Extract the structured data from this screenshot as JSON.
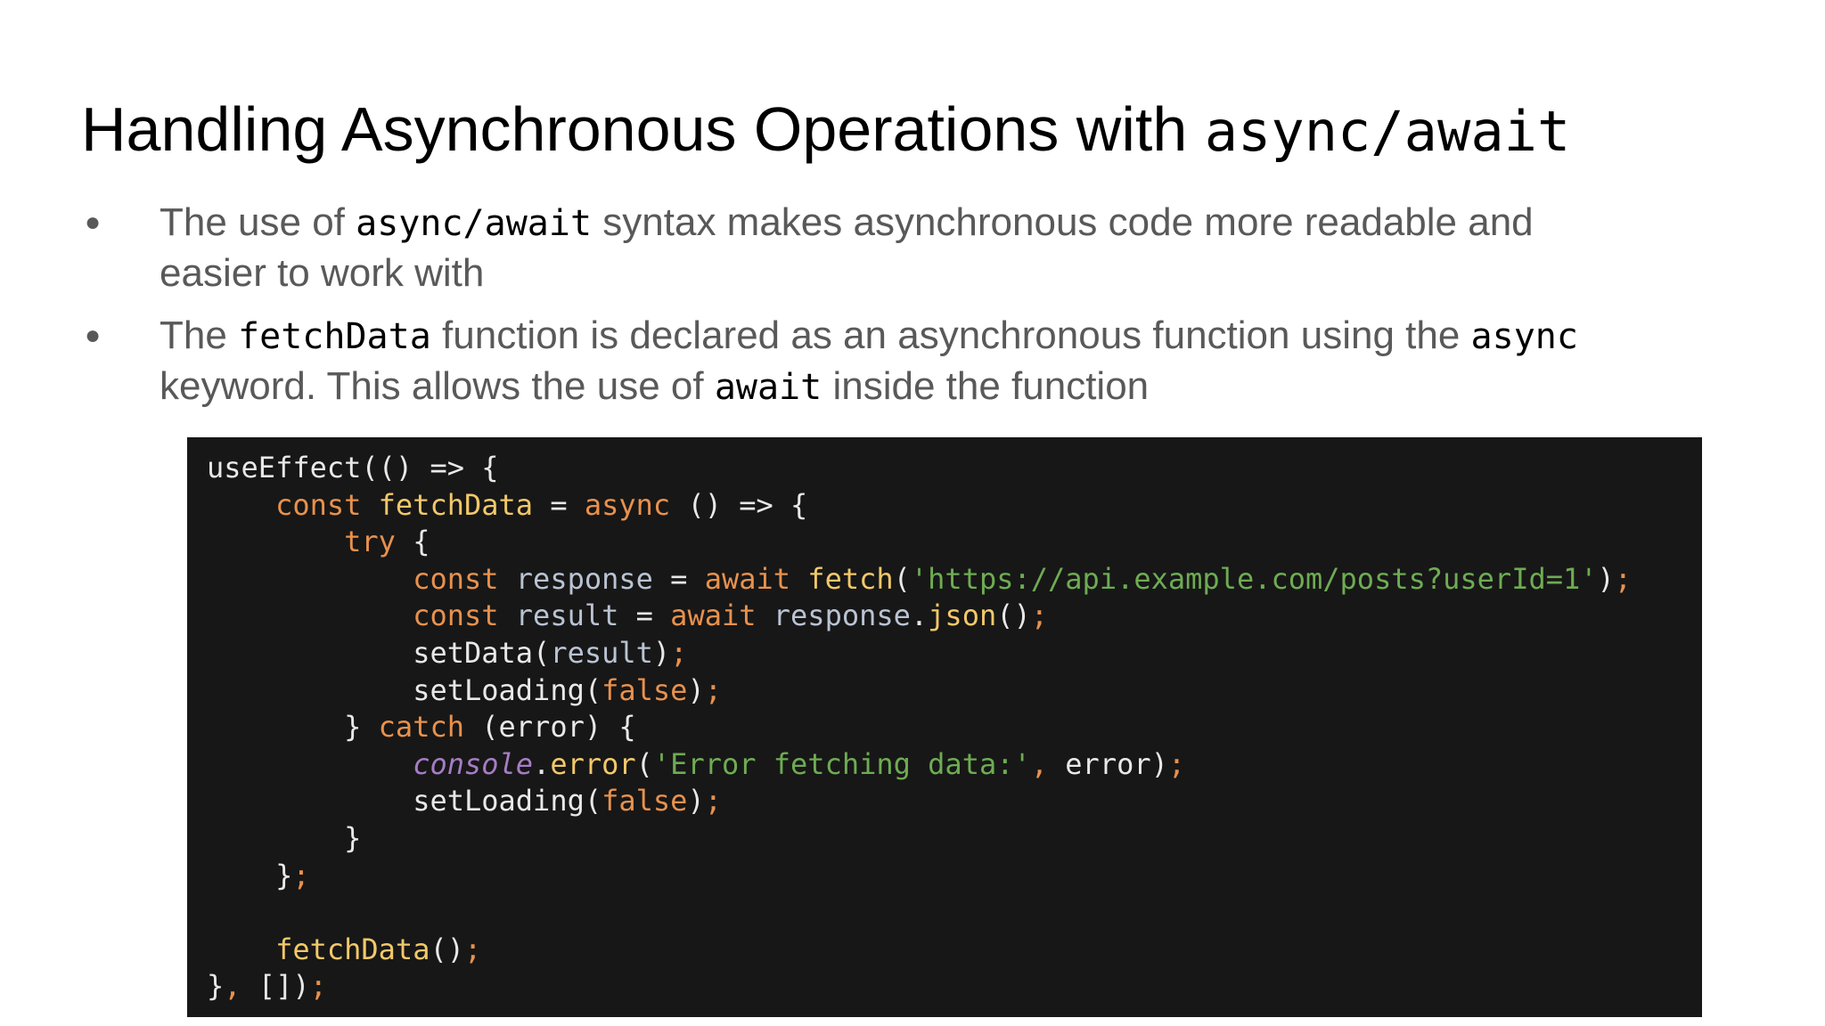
{
  "slide": {
    "title_text": "Handling Asynchronous Operations with ",
    "title_code": "async/await",
    "bullets": [
      {
        "part1": "The use of ",
        "code1": "async/await",
        "part2": "  syntax makes asynchronous code more readable and easier to work with"
      },
      {
        "part1": "The ",
        "code1": "fetchData",
        "part2": " function is declared as an asynchronous function using the ",
        "code2": "async",
        "part3": " keyword. This allows the use of ",
        "code3": "await",
        "part4": " inside the function"
      }
    ],
    "bullet_marker": "●"
  },
  "code_block": {
    "lines": [
      [
        {
          "t": "useEffect(() => {",
          "c": "def"
        }
      ],
      [
        {
          "t": "    ",
          "c": "def"
        },
        {
          "t": "const",
          "c": "kw"
        },
        {
          "t": " ",
          "c": "def"
        },
        {
          "t": "fetchData",
          "c": "fn"
        },
        {
          "t": " = ",
          "c": "def"
        },
        {
          "t": "async",
          "c": "kw"
        },
        {
          "t": " () => {",
          "c": "def"
        }
      ],
      [
        {
          "t": "        ",
          "c": "def"
        },
        {
          "t": "try",
          "c": "kw"
        },
        {
          "t": " {",
          "c": "def"
        }
      ],
      [
        {
          "t": "            ",
          "c": "def"
        },
        {
          "t": "const",
          "c": "kw"
        },
        {
          "t": " ",
          "c": "def"
        },
        {
          "t": "response",
          "c": "var"
        },
        {
          "t": " = ",
          "c": "def"
        },
        {
          "t": "await",
          "c": "kw"
        },
        {
          "t": " ",
          "c": "def"
        },
        {
          "t": "fetch",
          "c": "fn"
        },
        {
          "t": "(",
          "c": "def"
        },
        {
          "t": "'https://api.example.com/posts?userId=1'",
          "c": "str"
        },
        {
          "t": ")",
          "c": "def"
        },
        {
          "t": ";",
          "c": "pun"
        }
      ],
      [
        {
          "t": "            ",
          "c": "def"
        },
        {
          "t": "const",
          "c": "kw"
        },
        {
          "t": " ",
          "c": "def"
        },
        {
          "t": "result",
          "c": "var"
        },
        {
          "t": " = ",
          "c": "def"
        },
        {
          "t": "await",
          "c": "kw"
        },
        {
          "t": " ",
          "c": "def"
        },
        {
          "t": "response",
          "c": "var"
        },
        {
          "t": ".",
          "c": "def"
        },
        {
          "t": "json",
          "c": "fn"
        },
        {
          "t": "()",
          "c": "def"
        },
        {
          "t": ";",
          "c": "pun"
        }
      ],
      [
        {
          "t": "            setData(",
          "c": "def"
        },
        {
          "t": "result",
          "c": "var"
        },
        {
          "t": ")",
          "c": "def"
        },
        {
          "t": ";",
          "c": "pun"
        }
      ],
      [
        {
          "t": "            setLoading(",
          "c": "def"
        },
        {
          "t": "false",
          "c": "kw"
        },
        {
          "t": ")",
          "c": "def"
        },
        {
          "t": ";",
          "c": "pun"
        }
      ],
      [
        {
          "t": "        } ",
          "c": "def"
        },
        {
          "t": "catch",
          "c": "kw"
        },
        {
          "t": " (error) {",
          "c": "def"
        }
      ],
      [
        {
          "t": "            ",
          "c": "def"
        },
        {
          "t": "console",
          "c": "con"
        },
        {
          "t": ".",
          "c": "def"
        },
        {
          "t": "error",
          "c": "fn"
        },
        {
          "t": "(",
          "c": "def"
        },
        {
          "t": "'Error fetching data:'",
          "c": "str"
        },
        {
          "t": ",",
          "c": "pun"
        },
        {
          "t": " error)",
          "c": "def"
        },
        {
          "t": ";",
          "c": "pun"
        }
      ],
      [
        {
          "t": "            setLoading(",
          "c": "def"
        },
        {
          "t": "false",
          "c": "kw"
        },
        {
          "t": ")",
          "c": "def"
        },
        {
          "t": ";",
          "c": "pun"
        }
      ],
      [
        {
          "t": "        }",
          "c": "def"
        }
      ],
      [
        {
          "t": "    }",
          "c": "def"
        },
        {
          "t": ";",
          "c": "pun"
        }
      ],
      [
        {
          "t": "",
          "c": "def"
        }
      ],
      [
        {
          "t": "    ",
          "c": "def"
        },
        {
          "t": "fetchData",
          "c": "fn"
        },
        {
          "t": "()",
          "c": "def"
        },
        {
          "t": ";",
          "c": "pun"
        }
      ],
      [
        {
          "t": "}",
          "c": "def"
        },
        {
          "t": ",",
          "c": "pun"
        },
        {
          "t": " [])",
          "c": "def"
        },
        {
          "t": ";",
          "c": "pun"
        }
      ]
    ]
  }
}
